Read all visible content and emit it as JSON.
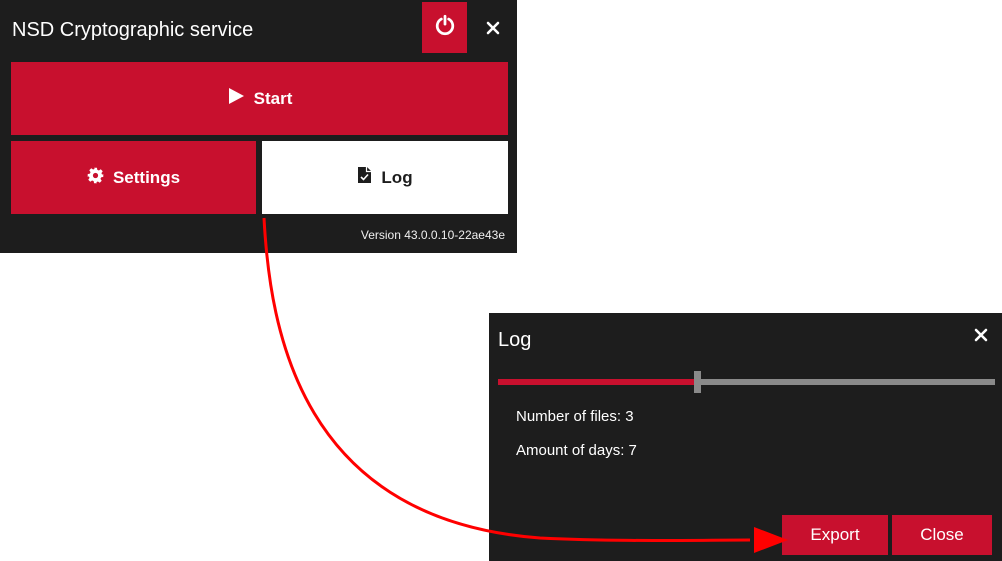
{
  "main_window": {
    "title": "NSD Cryptographic service",
    "start_label": "Start",
    "settings_label": "Settings",
    "log_label": "Log",
    "version": "Version 43.0.0.10-22ae43e"
  },
  "log_window": {
    "title": "Log",
    "slider": {
      "value_percent": 40
    },
    "files_text": "Number of files: 3",
    "days_text": "Amount of days: 7",
    "export_label": "Export",
    "close_label": "Close"
  },
  "icons": {
    "power": "power-icon",
    "close": "close-icon",
    "play": "play-icon",
    "settings": "gear-icon",
    "log": "document-icon"
  },
  "colors": {
    "accent": "#c8102e",
    "panel_bg": "#1d1d1d",
    "annotation_arrow": "#ff0000"
  }
}
